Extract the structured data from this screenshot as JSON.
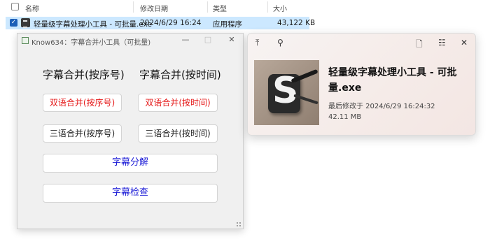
{
  "explorer": {
    "columns": {
      "name": "名称",
      "modified": "修改日期",
      "type": "类型",
      "size": "大小"
    },
    "file": {
      "name": "轻量级字幕处理小工具 - 可批量.exe",
      "modified": "2024/6/29 16:24",
      "type": "应用程序",
      "size": "43,122 KB",
      "checkmark": "✓"
    }
  },
  "app": {
    "title": "Know634：字幕合并小工具（可批量)",
    "controls": {
      "minimize": "—",
      "maximize": "□",
      "close": "✕"
    },
    "left_heading": "字幕合并(按序号)",
    "right_heading": "字幕合并(按时间)",
    "btn_bi_seq": "双语合并(按序号)",
    "btn_bi_time": "双语合并(按时间)",
    "btn_tri_seq": "三语合并(按序号)",
    "btn_tri_time": "三语合并(按时间)",
    "btn_split": "字幕分解",
    "btn_check": "字幕检查",
    "colors": {
      "red_text": "#e51a1a",
      "blue_text": "#1a1ad6"
    }
  },
  "preview": {
    "icons": [
      "export-icon",
      "pin-icon",
      "document-icon",
      "list-icon",
      "close-icon"
    ],
    "glyphs": {
      "export": "⤒",
      "pin": "⚲",
      "document": "🗋",
      "list": "☷",
      "close": "✕"
    },
    "name": "轻量级字幕处理小工具 - 可批量.exe",
    "modified": "最后修改于 2024/6/29 16:24:32",
    "size": "42.11 MB"
  }
}
